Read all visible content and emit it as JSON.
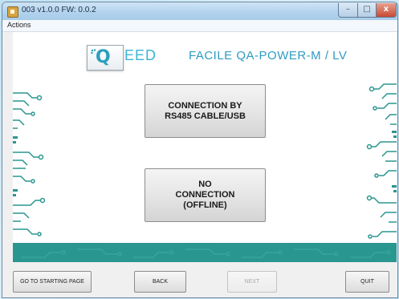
{
  "window": {
    "title": "003 v1.0.0 FW: 0.0.2",
    "controls": {
      "minimize": "–",
      "maximize": "□",
      "close": "x"
    }
  },
  "menu": {
    "items": [
      "Actions"
    ]
  },
  "logo": {
    "letter": "Q",
    "text": "EED"
  },
  "product": {
    "title": "FACILE QA-POWER-M / LV"
  },
  "main": {
    "connect_button": "CONNECTION BY\nRS485 CABLE/USB",
    "offline_button": "NO\nCONNECTION\n(OFFLINE)"
  },
  "footer": {
    "start_label": "GO TO STARTING PAGE",
    "back_label": "BACK",
    "next_label": "NEXT",
    "quit_label": "QUIT",
    "next_disabled": true
  },
  "colors": {
    "accent": "#2f9cc1",
    "band": "#2a9690",
    "circuit": "#2a9690"
  }
}
